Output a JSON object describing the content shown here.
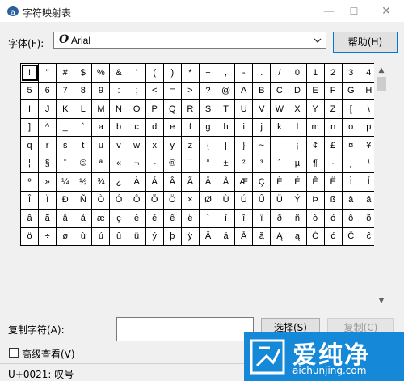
{
  "window": {
    "title": "字符映射表",
    "minimize": "—",
    "maximize": "☐",
    "close": "✕"
  },
  "font": {
    "label": "字体(F):",
    "icon": "O",
    "selected": "Arial"
  },
  "help_button": "帮助(H)",
  "grid": [
    [
      "!",
      "\"",
      "#",
      "$",
      "%",
      "&",
      "'",
      "(",
      ")",
      "*",
      "+",
      ",",
      "-",
      ".",
      "/",
      "0",
      "1",
      "2",
      "3",
      "4"
    ],
    [
      "5",
      "6",
      "7",
      "8",
      "9",
      ":",
      ";",
      "<",
      "=",
      ">",
      "?",
      "@",
      "A",
      "B",
      "C",
      "D",
      "E",
      "F",
      "G",
      "H"
    ],
    [
      "I",
      "J",
      "K",
      "L",
      "M",
      "N",
      "O",
      "P",
      "Q",
      "R",
      "S",
      "T",
      "U",
      "V",
      "W",
      "X",
      "Y",
      "Z",
      "[",
      "\\"
    ],
    [
      "]",
      "^",
      "_",
      "`",
      "a",
      "b",
      "c",
      "d",
      "e",
      "f",
      "g",
      "h",
      "i",
      "j",
      "k",
      "l",
      "m",
      "n",
      "o",
      "p"
    ],
    [
      "q",
      "r",
      "s",
      "t",
      "u",
      "v",
      "w",
      "x",
      "y",
      "z",
      "{",
      "|",
      "}",
      "~",
      " ",
      "¡",
      "¢",
      "£",
      "¤",
      "¥"
    ],
    [
      "¦",
      "§",
      "¨",
      "©",
      "ª",
      "«",
      "¬",
      "-",
      "®",
      "¯",
      "°",
      "±",
      "²",
      "³",
      "´",
      "µ",
      "¶",
      "·",
      "¸",
      "¹"
    ],
    [
      "º",
      "»",
      "¼",
      "½",
      "¾",
      "¿",
      "À",
      "Á",
      "Â",
      "Ã",
      "Ä",
      "Å",
      "Æ",
      "Ç",
      "È",
      "É",
      "Ê",
      "Ë",
      "Ì",
      "Í"
    ],
    [
      "Î",
      "Ï",
      "Ð",
      "Ñ",
      "Ò",
      "Ó",
      "Ô",
      "Õ",
      "Ö",
      "×",
      "Ø",
      "Ù",
      "Ú",
      "Û",
      "Ü",
      "Ý",
      "Þ",
      "ß",
      "à",
      "á"
    ],
    [
      "â",
      "ã",
      "ä",
      "å",
      "æ",
      "ç",
      "è",
      "é",
      "ê",
      "ë",
      "ì",
      "í",
      "î",
      "ï",
      "ð",
      "ñ",
      "ò",
      "ó",
      "ô",
      "õ"
    ],
    [
      "ö",
      "÷",
      "ø",
      "ù",
      "ú",
      "û",
      "ü",
      "ý",
      "þ",
      "ÿ",
      "Ā",
      "ā",
      "Ă",
      "ă",
      "Ą",
      "ą",
      "Ć",
      "ć",
      "Ĉ",
      "ĉ"
    ]
  ],
  "scrollbar": {
    "up": "▲",
    "down": "▼"
  },
  "copy": {
    "label": "复制字符(A):",
    "value": "",
    "select_button": "选择(S)",
    "copy_button": "复制(C)"
  },
  "advanced": {
    "label": "高级查看(V)"
  },
  "status": {
    "text": "U+0021: 叹号"
  },
  "watermark": {
    "text": "爱纯净",
    "url": "aichunjing.com"
  },
  "colors": {
    "watermark_bg": "#1688d8",
    "accent": "#0078d7"
  }
}
